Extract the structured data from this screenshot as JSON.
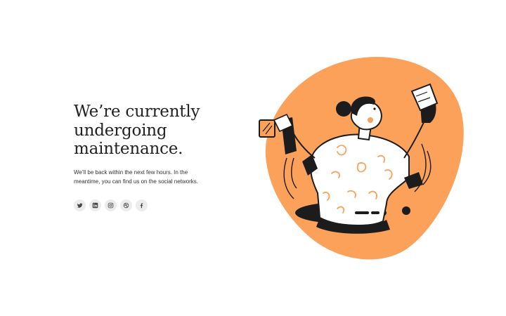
{
  "hero": {
    "headline_lines": [
      "We’re currently",
      "undergoing",
      "maintenance."
    ],
    "subtext_lines": [
      "We’ll be back within the next few hours. In the",
      "meantime, you can find us on the social networks."
    ]
  },
  "socials": [
    {
      "icon": "twitter-icon"
    },
    {
      "icon": "linkedin-icon"
    },
    {
      "icon": "instagram-icon"
    },
    {
      "icon": "dribbble-icon"
    },
    {
      "icon": "facebook-icon"
    }
  ],
  "colors": {
    "accent": "#FBA15A",
    "ink": "#1c1c1c",
    "social_bg": "#ececec"
  }
}
